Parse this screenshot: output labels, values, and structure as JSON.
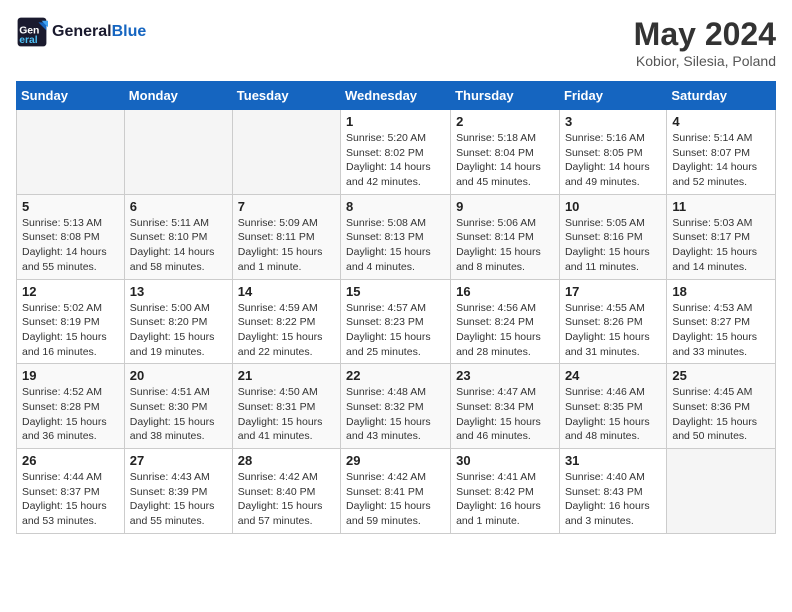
{
  "header": {
    "logo_general": "General",
    "logo_blue": "Blue",
    "month_year": "May 2024",
    "location": "Kobior, Silesia, Poland"
  },
  "weekdays": [
    "Sunday",
    "Monday",
    "Tuesday",
    "Wednesday",
    "Thursday",
    "Friday",
    "Saturday"
  ],
  "weeks": [
    [
      {
        "day": "",
        "sunrise": "",
        "sunset": "",
        "daylight": ""
      },
      {
        "day": "",
        "sunrise": "",
        "sunset": "",
        "daylight": ""
      },
      {
        "day": "",
        "sunrise": "",
        "sunset": "",
        "daylight": ""
      },
      {
        "day": "1",
        "sunrise": "Sunrise: 5:20 AM",
        "sunset": "Sunset: 8:02 PM",
        "daylight": "Daylight: 14 hours and 42 minutes."
      },
      {
        "day": "2",
        "sunrise": "Sunrise: 5:18 AM",
        "sunset": "Sunset: 8:04 PM",
        "daylight": "Daylight: 14 hours and 45 minutes."
      },
      {
        "day": "3",
        "sunrise": "Sunrise: 5:16 AM",
        "sunset": "Sunset: 8:05 PM",
        "daylight": "Daylight: 14 hours and 49 minutes."
      },
      {
        "day": "4",
        "sunrise": "Sunrise: 5:14 AM",
        "sunset": "Sunset: 8:07 PM",
        "daylight": "Daylight: 14 hours and 52 minutes."
      }
    ],
    [
      {
        "day": "5",
        "sunrise": "Sunrise: 5:13 AM",
        "sunset": "Sunset: 8:08 PM",
        "daylight": "Daylight: 14 hours and 55 minutes."
      },
      {
        "day": "6",
        "sunrise": "Sunrise: 5:11 AM",
        "sunset": "Sunset: 8:10 PM",
        "daylight": "Daylight: 14 hours and 58 minutes."
      },
      {
        "day": "7",
        "sunrise": "Sunrise: 5:09 AM",
        "sunset": "Sunset: 8:11 PM",
        "daylight": "Daylight: 15 hours and 1 minute."
      },
      {
        "day": "8",
        "sunrise": "Sunrise: 5:08 AM",
        "sunset": "Sunset: 8:13 PM",
        "daylight": "Daylight: 15 hours and 4 minutes."
      },
      {
        "day": "9",
        "sunrise": "Sunrise: 5:06 AM",
        "sunset": "Sunset: 8:14 PM",
        "daylight": "Daylight: 15 hours and 8 minutes."
      },
      {
        "day": "10",
        "sunrise": "Sunrise: 5:05 AM",
        "sunset": "Sunset: 8:16 PM",
        "daylight": "Daylight: 15 hours and 11 minutes."
      },
      {
        "day": "11",
        "sunrise": "Sunrise: 5:03 AM",
        "sunset": "Sunset: 8:17 PM",
        "daylight": "Daylight: 15 hours and 14 minutes."
      }
    ],
    [
      {
        "day": "12",
        "sunrise": "Sunrise: 5:02 AM",
        "sunset": "Sunset: 8:19 PM",
        "daylight": "Daylight: 15 hours and 16 minutes."
      },
      {
        "day": "13",
        "sunrise": "Sunrise: 5:00 AM",
        "sunset": "Sunset: 8:20 PM",
        "daylight": "Daylight: 15 hours and 19 minutes."
      },
      {
        "day": "14",
        "sunrise": "Sunrise: 4:59 AM",
        "sunset": "Sunset: 8:22 PM",
        "daylight": "Daylight: 15 hours and 22 minutes."
      },
      {
        "day": "15",
        "sunrise": "Sunrise: 4:57 AM",
        "sunset": "Sunset: 8:23 PM",
        "daylight": "Daylight: 15 hours and 25 minutes."
      },
      {
        "day": "16",
        "sunrise": "Sunrise: 4:56 AM",
        "sunset": "Sunset: 8:24 PM",
        "daylight": "Daylight: 15 hours and 28 minutes."
      },
      {
        "day": "17",
        "sunrise": "Sunrise: 4:55 AM",
        "sunset": "Sunset: 8:26 PM",
        "daylight": "Daylight: 15 hours and 31 minutes."
      },
      {
        "day": "18",
        "sunrise": "Sunrise: 4:53 AM",
        "sunset": "Sunset: 8:27 PM",
        "daylight": "Daylight: 15 hours and 33 minutes."
      }
    ],
    [
      {
        "day": "19",
        "sunrise": "Sunrise: 4:52 AM",
        "sunset": "Sunset: 8:28 PM",
        "daylight": "Daylight: 15 hours and 36 minutes."
      },
      {
        "day": "20",
        "sunrise": "Sunrise: 4:51 AM",
        "sunset": "Sunset: 8:30 PM",
        "daylight": "Daylight: 15 hours and 38 minutes."
      },
      {
        "day": "21",
        "sunrise": "Sunrise: 4:50 AM",
        "sunset": "Sunset: 8:31 PM",
        "daylight": "Daylight: 15 hours and 41 minutes."
      },
      {
        "day": "22",
        "sunrise": "Sunrise: 4:48 AM",
        "sunset": "Sunset: 8:32 PM",
        "daylight": "Daylight: 15 hours and 43 minutes."
      },
      {
        "day": "23",
        "sunrise": "Sunrise: 4:47 AM",
        "sunset": "Sunset: 8:34 PM",
        "daylight": "Daylight: 15 hours and 46 minutes."
      },
      {
        "day": "24",
        "sunrise": "Sunrise: 4:46 AM",
        "sunset": "Sunset: 8:35 PM",
        "daylight": "Daylight: 15 hours and 48 minutes."
      },
      {
        "day": "25",
        "sunrise": "Sunrise: 4:45 AM",
        "sunset": "Sunset: 8:36 PM",
        "daylight": "Daylight: 15 hours and 50 minutes."
      }
    ],
    [
      {
        "day": "26",
        "sunrise": "Sunrise: 4:44 AM",
        "sunset": "Sunset: 8:37 PM",
        "daylight": "Daylight: 15 hours and 53 minutes."
      },
      {
        "day": "27",
        "sunrise": "Sunrise: 4:43 AM",
        "sunset": "Sunset: 8:39 PM",
        "daylight": "Daylight: 15 hours and 55 minutes."
      },
      {
        "day": "28",
        "sunrise": "Sunrise: 4:42 AM",
        "sunset": "Sunset: 8:40 PM",
        "daylight": "Daylight: 15 hours and 57 minutes."
      },
      {
        "day": "29",
        "sunrise": "Sunrise: 4:42 AM",
        "sunset": "Sunset: 8:41 PM",
        "daylight": "Daylight: 15 hours and 59 minutes."
      },
      {
        "day": "30",
        "sunrise": "Sunrise: 4:41 AM",
        "sunset": "Sunset: 8:42 PM",
        "daylight": "Daylight: 16 hours and 1 minute."
      },
      {
        "day": "31",
        "sunrise": "Sunrise: 4:40 AM",
        "sunset": "Sunset: 8:43 PM",
        "daylight": "Daylight: 16 hours and 3 minutes."
      },
      {
        "day": "",
        "sunrise": "",
        "sunset": "",
        "daylight": ""
      }
    ]
  ]
}
